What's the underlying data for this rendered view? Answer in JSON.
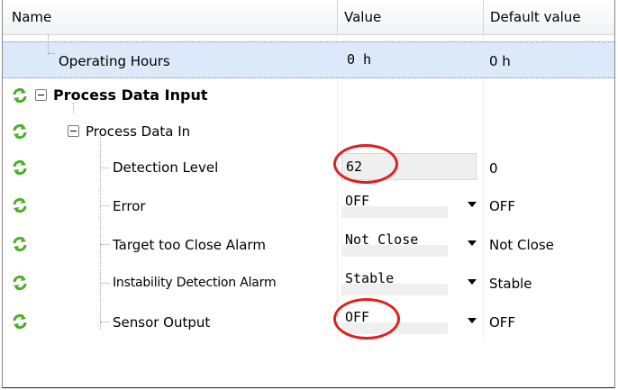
{
  "columns": {
    "name": "Name",
    "value": "Value",
    "default": "Default value"
  },
  "rows": [
    {
      "name": "Operating Hours",
      "value": "0 h",
      "default": "0 h"
    },
    {
      "name": "Process Data Input"
    },
    {
      "name": "Process Data In"
    },
    {
      "name": "Detection Level",
      "value": "62",
      "default": "0"
    },
    {
      "name": "Error",
      "value": "OFF",
      "default": "OFF"
    },
    {
      "name": "Target too Close Alarm",
      "value": "Not Close",
      "default": "Not Close"
    },
    {
      "name": "Instability Detection Alarm",
      "value": "Stable",
      "default": "Stable"
    },
    {
      "name": "Sensor Output",
      "value": "OFF",
      "default": "OFF"
    }
  ],
  "icons": {
    "refresh": "refresh-icon",
    "dropdown": "chevron-down-icon",
    "collapse": "collapse-toggle-icon"
  },
  "colors": {
    "selected_row": "#dce9f8",
    "annotation": "#e02020",
    "refresh_icon": "#4caf2a"
  }
}
